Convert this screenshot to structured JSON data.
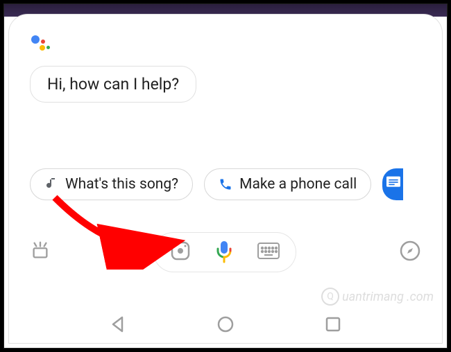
{
  "greeting": "Hi, how can I help?",
  "chips": [
    {
      "label": "What's this song?",
      "icon": "music-note"
    },
    {
      "label": "Make a phone call",
      "icon": "phone"
    }
  ],
  "watermark": "uantrimang",
  "colors": {
    "blue": "#4285F4",
    "red": "#EA4335",
    "yellow": "#FBBC05",
    "green": "#34A853",
    "gray": "#9e9e9e",
    "arrow": "#FF0000"
  },
  "icons": {
    "updates": "updates-icon",
    "lens": "lens-icon",
    "mic": "mic-icon",
    "keyboard": "keyboard-icon",
    "explore": "compass-icon",
    "nav_back": "nav-back",
    "nav_home": "nav-home",
    "nav_recent": "nav-recent"
  }
}
